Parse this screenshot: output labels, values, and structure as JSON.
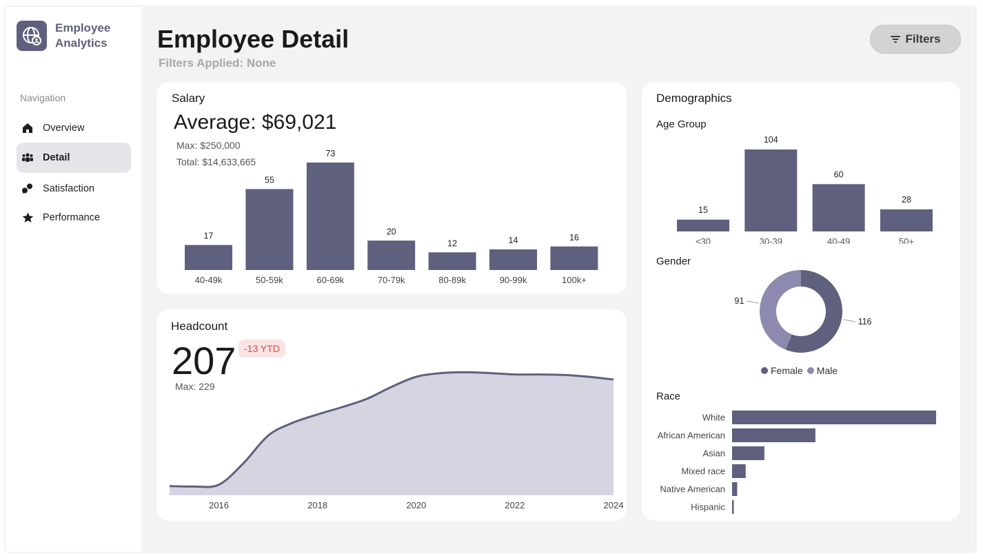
{
  "app": {
    "brand_line1": "Employee",
    "brand_line2": "Analytics",
    "accent_color": "#5f5f7e",
    "light_accent": "#8c8aaf",
    "area_fill": "#d5d4e1"
  },
  "sidebar": {
    "header": "Navigation",
    "items": [
      {
        "label": "Overview",
        "icon": "home-icon"
      },
      {
        "label": "Detail",
        "icon": "people-icon",
        "active": true
      },
      {
        "label": "Satisfaction",
        "icon": "chat-icon"
      },
      {
        "label": "Performance",
        "icon": "star-icon"
      }
    ]
  },
  "header": {
    "title": "Employee Detail",
    "subtitle": "Filters Applied: None",
    "filters_label": "Filters"
  },
  "salary": {
    "title": "Salary",
    "average": "Average: $69,021",
    "max": "Max: $250,000",
    "total": "Total: $14,633,665"
  },
  "headcount": {
    "title": "Headcount",
    "value": "207",
    "ytd": "-13 YTD",
    "max": "Max: 229"
  },
  "demographics": {
    "title": "Demographics",
    "age_title": "Age Group",
    "gender_title": "Gender",
    "race_title": "Race",
    "gender_legend": [
      "Female",
      "Male"
    ]
  },
  "chart_data": [
    {
      "id": "salary",
      "type": "bar",
      "categories": [
        "40-49k",
        "50-59k",
        "60-69k",
        "70-79k",
        "80-89k",
        "90-99k",
        "100k+"
      ],
      "values": [
        17,
        55,
        73,
        20,
        12,
        14,
        16
      ],
      "ylim": [
        0,
        73
      ]
    },
    {
      "id": "headcount",
      "type": "area",
      "x": [
        2015,
        2015.5,
        2016,
        2016.5,
        2017,
        2017.5,
        2018,
        2018.5,
        2019,
        2019.5,
        2020,
        2020.5,
        2021,
        2021.5,
        2022,
        2022.5,
        2023,
        2023.5,
        2024
      ],
      "values": [
        20,
        19,
        23,
        70,
        130,
        158,
        176,
        192,
        210,
        236,
        258,
        266,
        268,
        266,
        263,
        263,
        262,
        258,
        252
      ],
      "xticks": [
        "2016",
        "2018",
        "2020",
        "2022",
        "2024"
      ],
      "xlim": [
        2015,
        2024
      ],
      "ylim": [
        0,
        300
      ]
    },
    {
      "id": "age",
      "type": "bar",
      "categories": [
        "<30",
        "30-39",
        "40-49",
        "50+"
      ],
      "values": [
        15,
        104,
        60,
        28
      ],
      "ylim": [
        0,
        104
      ]
    },
    {
      "id": "gender",
      "type": "pie",
      "labels": [
        "Female",
        "Male"
      ],
      "values": [
        116,
        91
      ],
      "colors": [
        "#5f5f7e",
        "#8c8aaf"
      ]
    },
    {
      "id": "race",
      "type": "bar",
      "orientation": "horizontal",
      "categories": [
        "White",
        "African American",
        "Asian",
        "Mixed race",
        "Native American",
        "Hispanic"
      ],
      "values": [
        120,
        49,
        19,
        8,
        3,
        1
      ],
      "xlim": [
        0,
        120
      ]
    }
  ]
}
